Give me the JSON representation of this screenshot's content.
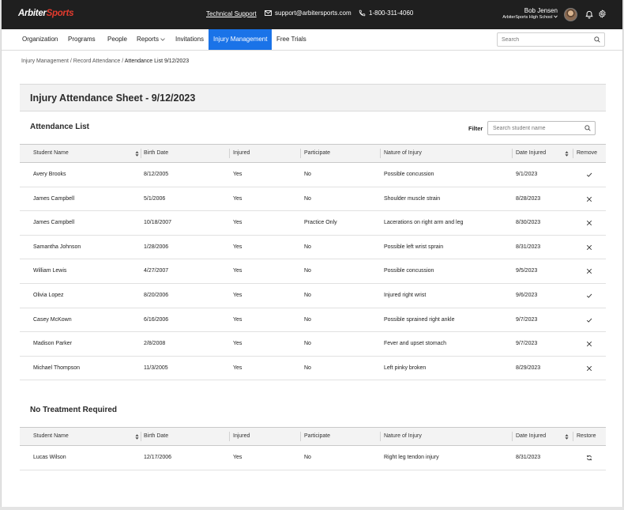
{
  "header": {
    "logo_part1": "Arbiter",
    "logo_part2": "Sports",
    "support_link": "Technical Support",
    "email": "support@arbitersports.com",
    "phone": "1-800-311-4060",
    "user_name": "Bob Jensen",
    "user_school": "ArbiterSports High School",
    "icons": [
      "mail-icon",
      "phone-icon",
      "chevron-down-icon",
      "avatar",
      "bell-icon",
      "gear-icon"
    ]
  },
  "nav": {
    "items": [
      "Organization",
      "Programs",
      "People",
      "Reports",
      "Invitations",
      "Injury Management",
      "Free Trials"
    ],
    "active": "Injury Management",
    "search_placeholder": "Search"
  },
  "breadcrumb": {
    "items": [
      "Injury Management",
      "Record Attendance"
    ],
    "separator": " / ",
    "current": "Attendance List 9/12/2023"
  },
  "page_title": "Injury Attendance Sheet - 9/12/2023",
  "attendance": {
    "title": "Attendance List",
    "filter_label": "Filter",
    "filter_placeholder": "Search student name",
    "columns": [
      "Student Name",
      "Birth Date",
      "Injured",
      "Participate",
      "Nature of Injury",
      "Date Injured",
      "Remove"
    ],
    "rows": [
      {
        "name": "Avery Brooks",
        "birth": "8/12/2005",
        "injured": "Yes",
        "participate": "No",
        "nature": "Possible concussion",
        "date": "9/1/2023",
        "action": "check"
      },
      {
        "name": "James Campbell",
        "birth": "5/1/2006",
        "injured": "Yes",
        "participate": "No",
        "nature": "Shoulder muscle strain",
        "date": "8/28/2023",
        "action": "remove"
      },
      {
        "name": "James Campbell",
        "birth": "10/18/2007",
        "injured": "Yes",
        "participate": "Practice Only",
        "nature": "Lacerations on right arm and leg",
        "date": "8/30/2023",
        "action": "remove"
      },
      {
        "name": "Samantha Johnson",
        "birth": "1/28/2006",
        "injured": "Yes",
        "participate": "No",
        "nature": "Possible left wrist sprain",
        "date": "8/31/2023",
        "action": "remove"
      },
      {
        "name": "William Lewis",
        "birth": "4/27/2007",
        "injured": "Yes",
        "participate": "No",
        "nature": "Possible concussion",
        "date": "9/5/2023",
        "action": "remove"
      },
      {
        "name": "Olivia Lopez",
        "birth": "8/20/2006",
        "injured": "Yes",
        "participate": "No",
        "nature": "Injured right wrist",
        "date": "9/6/2023",
        "action": "check"
      },
      {
        "name": "Casey McKown",
        "birth": "6/16/2006",
        "injured": "Yes",
        "participate": "No",
        "nature": "Possible sprained right ankle",
        "date": "9/7/2023",
        "action": "check"
      },
      {
        "name": "Madison Parker",
        "birth": "2/8/2008",
        "injured": "Yes",
        "participate": "No",
        "nature": "Fever and upset stomach",
        "date": "9/7/2023",
        "action": "remove"
      },
      {
        "name": "Michael Thompson",
        "birth": "11/3/2005",
        "injured": "Yes",
        "participate": "No",
        "nature": "Left pinky broken",
        "date": "8/29/2023",
        "action": "remove"
      }
    ]
  },
  "no_treatment": {
    "title": "No Treatment Required",
    "columns": [
      "Student Name",
      "Birth Date",
      "Injured",
      "Participate",
      "Nature of Injury",
      "Date Injured",
      "Restore"
    ],
    "rows": [
      {
        "name": "Lucas Wilson",
        "birth": "12/17/2006",
        "injured": "Yes",
        "participate": "No",
        "nature": "Right leg tendon injury",
        "date": "8/31/2023",
        "action": "restore"
      }
    ]
  },
  "colors": {
    "topbar": "#1f1f1f",
    "brand_red": "#e33b2e",
    "active_nav": "#1a73e8",
    "header_gray": "#f2f2f2"
  }
}
